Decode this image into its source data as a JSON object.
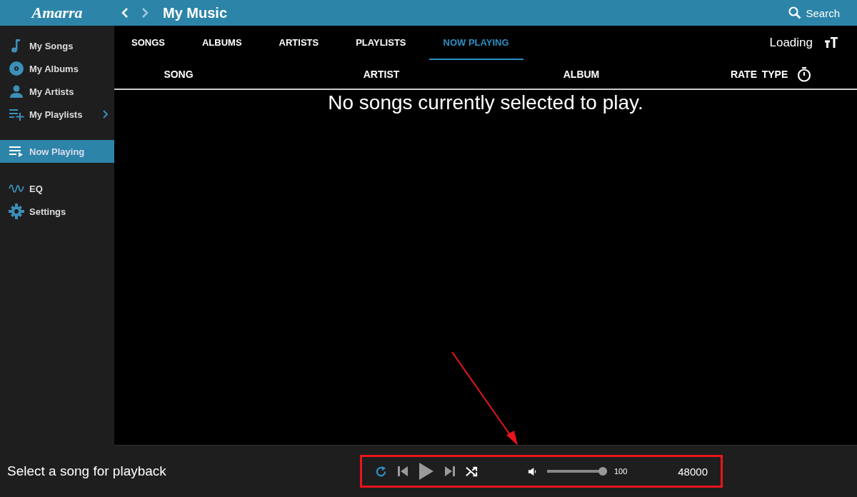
{
  "header": {
    "logo": "Amarra",
    "title": "My Music",
    "search_label": "Search"
  },
  "sidebar": {
    "groups": [
      [
        {
          "label": "My Songs",
          "selected": false
        },
        {
          "label": "My Albums",
          "selected": false
        },
        {
          "label": "My Artists",
          "selected": false
        },
        {
          "label": "My Playlists",
          "selected": false,
          "has_submenu": true
        }
      ],
      [
        {
          "label": "Now Playing",
          "selected": true
        }
      ],
      [
        {
          "label": "EQ",
          "selected": false
        },
        {
          "label": "Settings",
          "selected": false
        }
      ]
    ]
  },
  "tabs": [
    {
      "label": "SONGS",
      "selected": false
    },
    {
      "label": "ALBUMS",
      "selected": false
    },
    {
      "label": "ARTISTS",
      "selected": false
    },
    {
      "label": "PLAYLISTS",
      "selected": false
    },
    {
      "label": "NOW PLAYING",
      "selected": true
    }
  ],
  "status": "Loading",
  "columns": [
    "SONG",
    "ARTIST",
    "ALBUM",
    "RATE",
    "TYPE"
  ],
  "empty_message": "No songs currently selected to play.",
  "player": {
    "now_playing": "Select a song for playback",
    "repeat_on": true,
    "volume": {
      "level": 1,
      "reading": "100"
    },
    "sample_rate": "48000"
  }
}
